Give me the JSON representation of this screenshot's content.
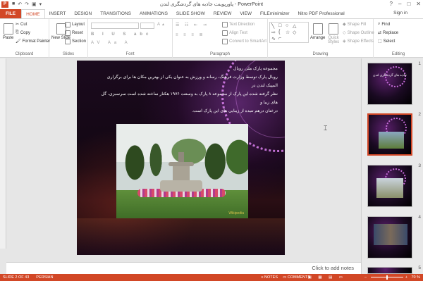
{
  "window": {
    "title": "پاورپوینت جاذبه های گردشگری لندن - PowerPoint",
    "app_logo": "P",
    "signin": "Sign in",
    "controls": [
      "?",
      "–",
      "□",
      "✕"
    ]
  },
  "tabs": [
    "FILE",
    "HOME",
    "INSERT",
    "DESIGN",
    "TRANSITIONS",
    "ANIMATIONS",
    "SLIDE SHOW",
    "REVIEW",
    "VIEW",
    "FILEminimizer",
    "Nitro PDF Professional"
  ],
  "ribbon": {
    "clipboard": {
      "label": "Clipboard",
      "paste": "Paste",
      "cut": "Cut",
      "copy": "Copy",
      "format_painter": "Format Painter"
    },
    "slides": {
      "label": "Slides",
      "new_slide": "New Slide",
      "layout": "Layout",
      "reset": "Reset",
      "section": "Section"
    },
    "font": {
      "label": "Font"
    },
    "paragraph": {
      "label": "Paragraph",
      "text_direction": "Text Direction",
      "align_text": "Align Text",
      "convert_smartart": "Convert to SmartArt"
    },
    "drawing": {
      "label": "Drawing",
      "arrange": "Arrange",
      "quick_styles": "Quick Styles",
      "shape_fill": "Shape Fill",
      "shape_outline": "Shape Outline",
      "shape_effects": "Shape Effects"
    },
    "editing": {
      "label": "Editing",
      "find": "Find",
      "replace": "Replace",
      "select": "Select"
    }
  },
  "slide": {
    "lines": [
      "مجموعه پارک ملی رویال",
      "رویال پارک توسط وزارت فرهنگ، رسانه و ورزش به عنوان یکی از بهترین مکان ها برای برگزاری المپیک لندن در",
      "نظر گرفته شده.این پارک از مجموعه ۸ پارک به وسعت ۱۹۷۶ هکتار ساخته شده است سرسبزی، گل های زیبا و",
      "درختان درهم تنیده از زیبایی های این پارک است."
    ],
    "photo_caption": "Wikipedia"
  },
  "thumbnails": [
    {
      "num": "1",
      "title": "جاذبه های گردشگری لندن"
    },
    {
      "num": "2",
      "title": ""
    },
    {
      "num": "3",
      "title": ""
    },
    {
      "num": "4",
      "title": ""
    },
    {
      "num": "5",
      "title": ""
    }
  ],
  "notes_placeholder": "Click to add notes",
  "status": {
    "slide": "SLIDE 2 OF 43",
    "language": "PERSIAN",
    "notes": "NOTES",
    "comments": "COMMENTS",
    "zoom": "70 %"
  },
  "colors": {
    "accent": "#d24726"
  }
}
